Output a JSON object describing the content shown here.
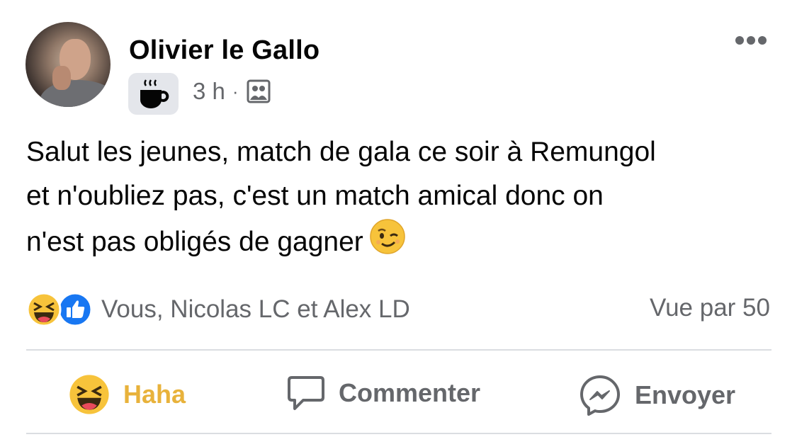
{
  "post": {
    "author": "Olivier le Gallo",
    "time": "3 h",
    "separator": "·",
    "audience_icon": "friends-group-icon",
    "badge_icon": "coffee-cup-icon",
    "text_lines": [
      "Salut les jeunes, match de gala ce soir à Remungol",
      "et n'oubliez pas, c'est un match amical donc on",
      "n'est pas obligés de gagner"
    ],
    "text_emoji": "winking-face-emoji",
    "more_icon": "more-options-icon"
  },
  "reactions": {
    "icons": [
      "haha-reaction-icon",
      "like-reaction-icon"
    ],
    "summary": "Vous, Nicolas LC et Alex LD",
    "seen_by": "Vue par 50"
  },
  "actions": {
    "react_label": "Haha",
    "comment_label": "Commenter",
    "send_label": "Envoyer"
  },
  "colors": {
    "text": "#050505",
    "secondary": "#65676b",
    "haha_active": "#e8b23b",
    "like_blue": "#1877f2",
    "divider": "#dadde1"
  }
}
